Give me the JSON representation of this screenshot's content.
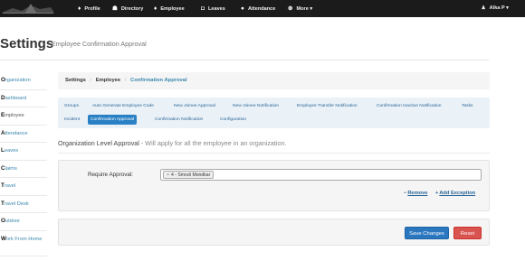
{
  "nav": {
    "items": [
      {
        "label": "Profile",
        "icon": "user-icon"
      },
      {
        "label": "Directory",
        "icon": "group-icon"
      },
      {
        "label": "Employee",
        "icon": "user-icon"
      },
      {
        "label": "Leaves",
        "icon": "camera-icon"
      },
      {
        "label": "Attendance",
        "icon": "clock-icon"
      },
      {
        "label": "More ▾",
        "icon": "plus-circle-icon"
      }
    ],
    "user": "Alka P ▾"
  },
  "header": {
    "title": "Settings",
    "subtitle": "Employee Confirmation Approval"
  },
  "sidebar": {
    "items": [
      {
        "cap": "O",
        "rest": "rganization"
      },
      {
        "cap": "D",
        "rest": "ashboard"
      },
      {
        "cap": "E",
        "rest": "mployee"
      },
      {
        "cap": "A",
        "rest": "ttendance"
      },
      {
        "cap": "L",
        "rest": "eaves"
      },
      {
        "cap": "C",
        "rest": "laims"
      },
      {
        "cap": "T",
        "rest": "ravel"
      },
      {
        "cap": "T",
        "rest": "ravel Desk"
      },
      {
        "cap": "O",
        "rest": "utdoor"
      },
      {
        "cap": "W",
        "rest": "ork From Home"
      }
    ]
  },
  "breadcrumb": {
    "items": [
      "Settings",
      "Employee"
    ],
    "separator": "/",
    "active": "Confirmation Approval"
  },
  "tabs": [
    "Groups",
    "Auto Generate Employee Code",
    "New Joinee Approval",
    "New Joinee Notification",
    "Employee Transfer Notification",
    "Confirmation Inactive Notification",
    "Tasks",
    "Incident",
    "Confirmation Approval",
    "Confirmation Notification",
    "Configuration"
  ],
  "section": {
    "heading": "Organization Level Approval",
    "hint": " - Will apply for all the employee in an organization."
  },
  "form": {
    "require_label": "Require Approval:",
    "chip_remove": "×",
    "chip": "4 - Smruti Mondkar",
    "remove_label": "Remove",
    "add_label": "Add Exception"
  },
  "actions": {
    "save": "Save Changes",
    "reset": "Reset"
  },
  "colors": {
    "navbar": "#1b1b1b",
    "link": "#3a87ad",
    "active_tab": "#2980c4",
    "primary": "#2a76bf",
    "danger": "#d9534f"
  }
}
